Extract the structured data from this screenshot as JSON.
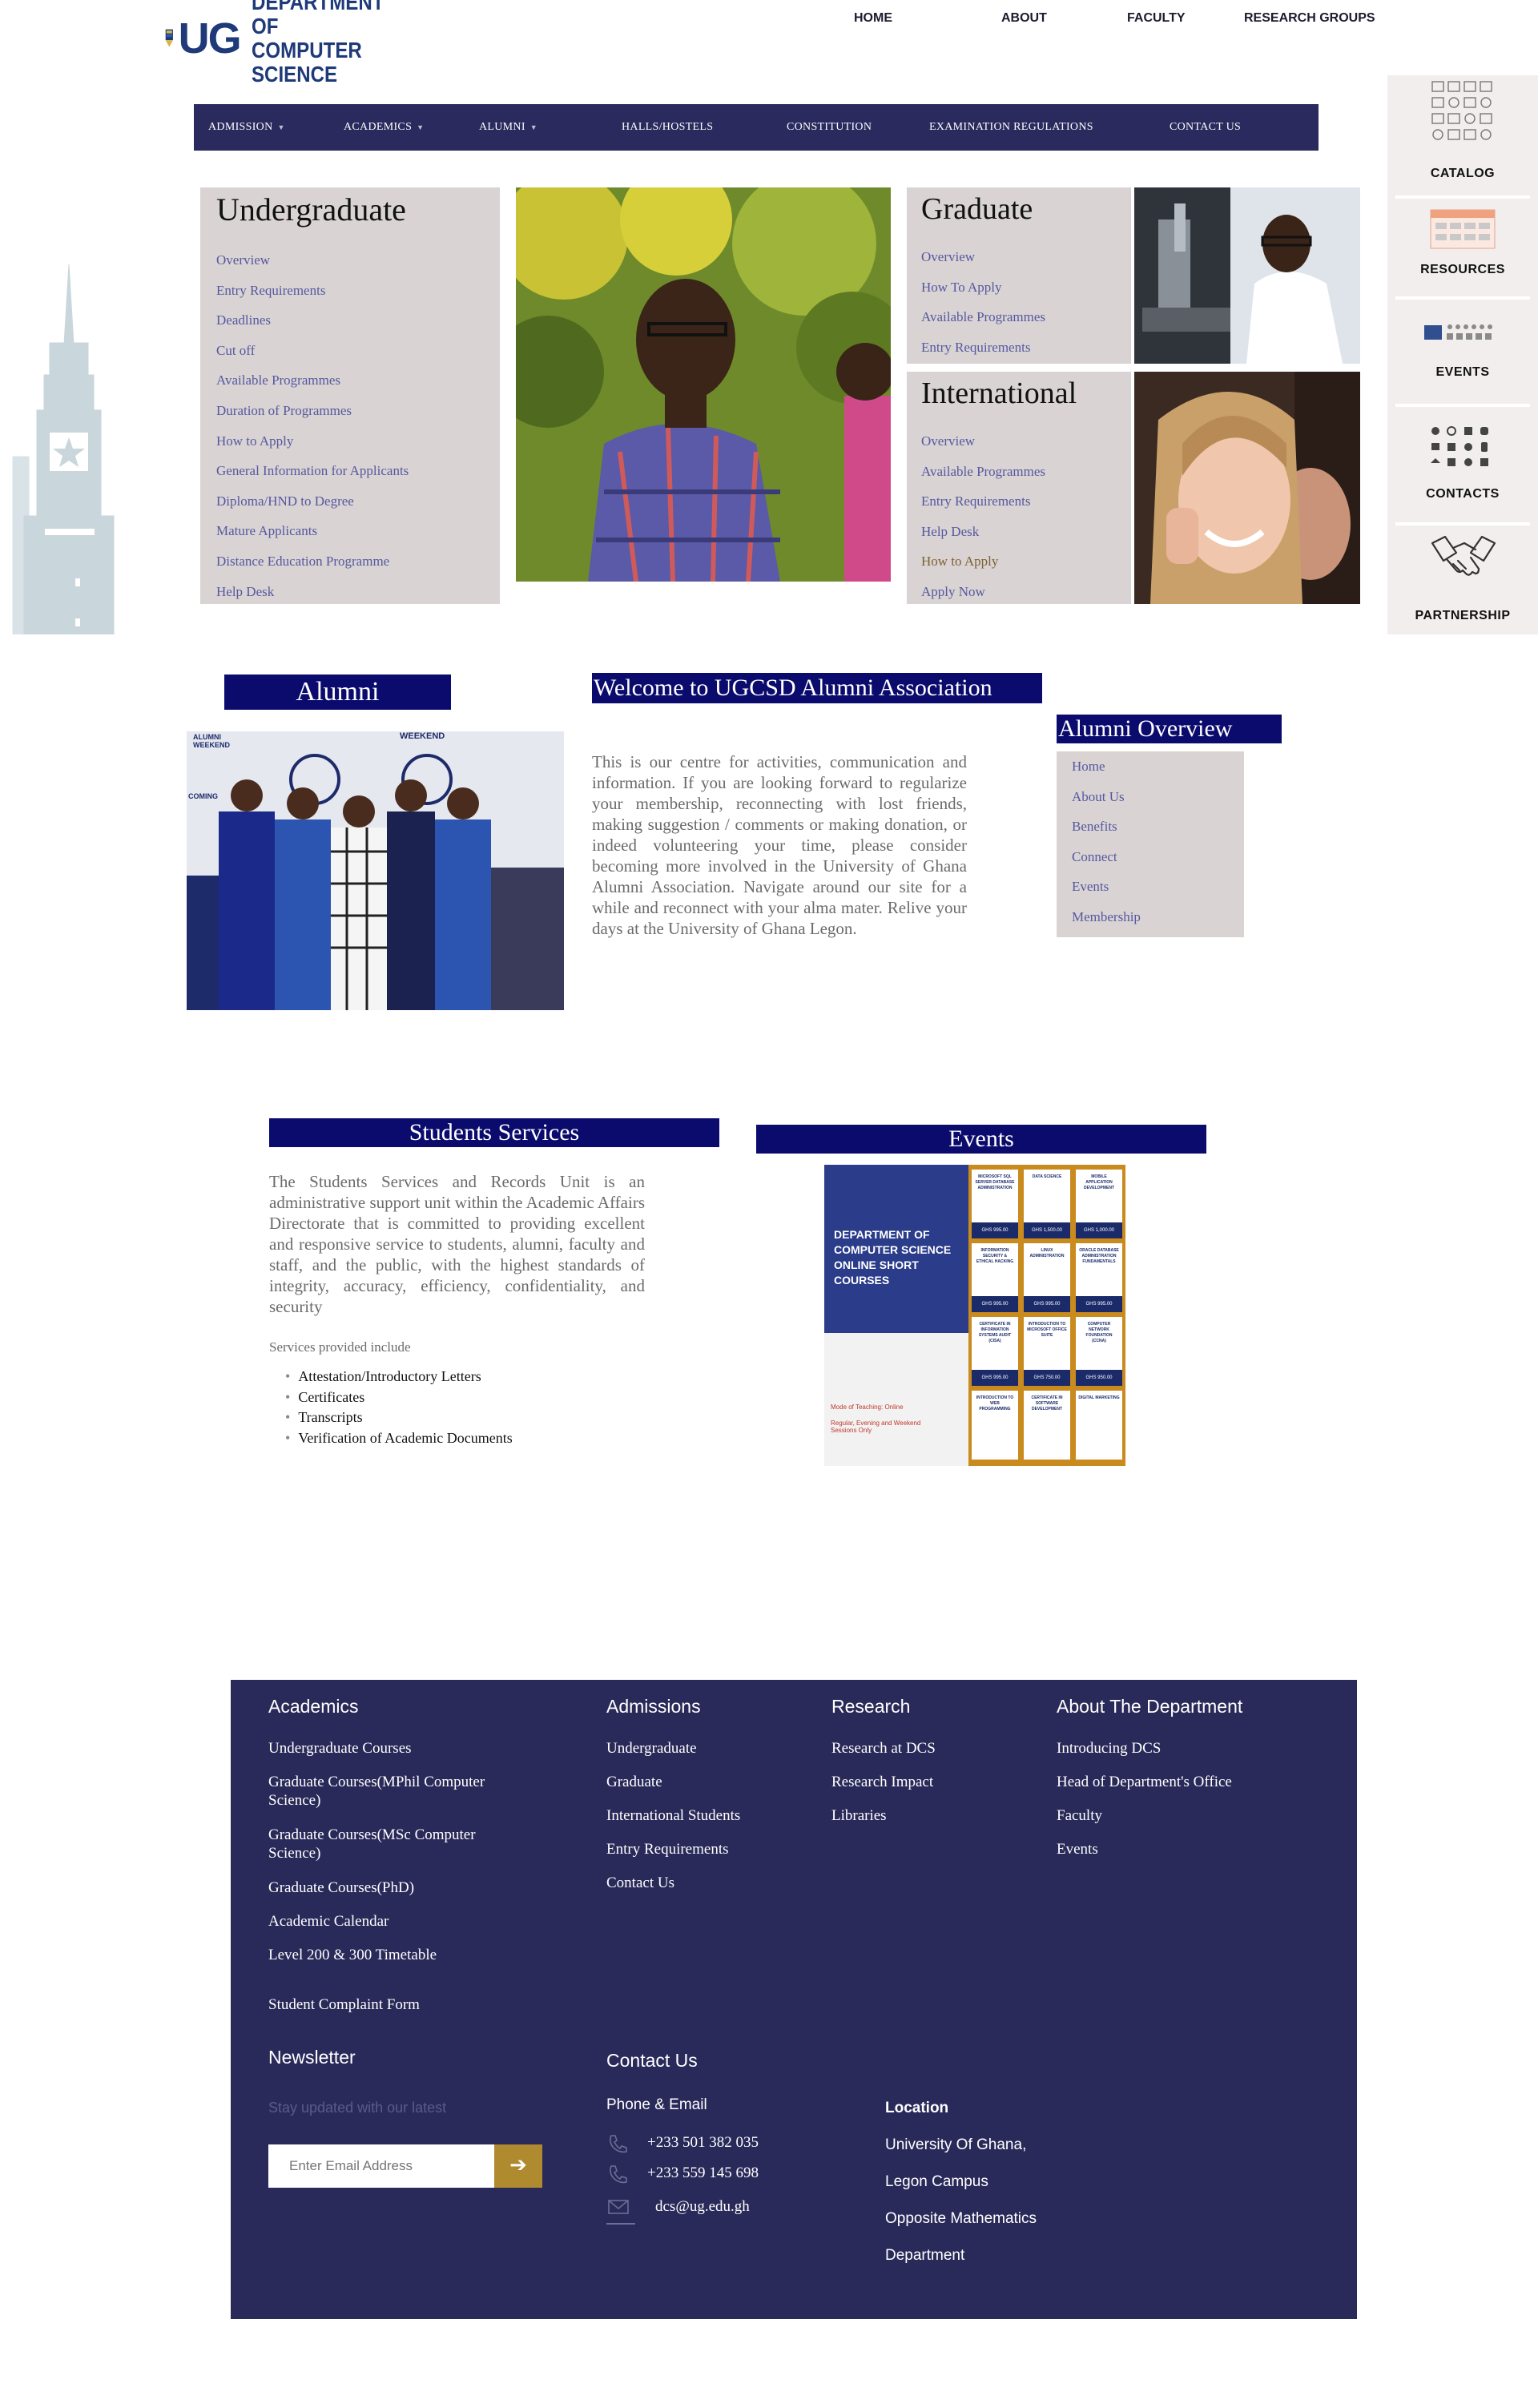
{
  "header": {
    "logo_mark": "UG",
    "logo_line1": "DEPARTMENT OF",
    "logo_line2": "COMPUTER SCIENCE",
    "top_nav": [
      "HOME",
      "ABOUT",
      "FACULTY",
      "RESEARCH GROUPS"
    ]
  },
  "navbar": {
    "items": [
      {
        "label": "ADMISSION",
        "dropdown": true
      },
      {
        "label": "ACADEMICS",
        "dropdown": true
      },
      {
        "label": "ALUMNI",
        "dropdown": true
      },
      {
        "label": "HALLS/HOSTELS",
        "dropdown": false
      },
      {
        "label": "CONSTITUTION",
        "dropdown": false
      },
      {
        "label": "EXAMINATION REGULATIONS",
        "dropdown": false
      },
      {
        "label": "CONTACT US",
        "dropdown": false
      }
    ]
  },
  "sidebar": {
    "items": [
      "CATALOG",
      "RESOURCES",
      "EVENTS",
      "CONTACTS",
      "PARTNERSHIP"
    ]
  },
  "undergraduate": {
    "title": "Undergraduate",
    "links": [
      "Overview",
      "Entry Requirements",
      "Deadlines",
      "Cut off",
      "Available Programmes",
      "Duration of Programmes",
      "How to Apply",
      "General Information for Applicants",
      "Diploma/HND to Degree",
      "Mature Applicants",
      "Distance Education Programme",
      "Help Desk"
    ]
  },
  "graduate": {
    "title": "Graduate",
    "links": [
      "Overview",
      "How To Apply",
      "Available Programmes",
      "Entry Requirements"
    ]
  },
  "international": {
    "title": "International",
    "links": [
      "Overview",
      "Available Programmes",
      "Entry Requirements",
      "Help Desk",
      "How to Apply",
      "Apply Now"
    ]
  },
  "alumni": {
    "heading": "Alumni",
    "photo_banner_left": "ALUMNI WEEKEND",
    "photo_banner_right": "WEEKEND",
    "photo_banner_coming": "COMING",
    "welcome_heading": "Welcome to UGCSD Alumni Association",
    "welcome_text": "This is our centre for activities, communication and information. If you are looking forward to regularize your membership, reconnecting with lost friends, making suggestion / comments or making donation, or indeed volunteering your time, please consider becoming more involved in the University of Ghana Alumni Association. Navigate around our site for a while and reconnect with your alma mater. Relive your days at the University of Ghana Legon.",
    "overview_heading": "Alumni Overview",
    "overview_links": [
      "Home",
      "About Us",
      "Benefits",
      "Connect",
      "Events",
      "Membership"
    ]
  },
  "students_services": {
    "heading": "Students Services",
    "text": "The Students Services and Records Unit is an administrative support unit within the Academic Affairs Directorate that is committed to providing excellent and responsive service to students, alumni, faculty and staff, and the public, with the highest standards of integrity, accuracy, efficiency, confidentiality, and security",
    "services_intro": "Services provided include",
    "services": [
      "Attestation/Introductory Letters",
      "Certificates",
      "Transcripts",
      "Verification of Academic Documents"
    ]
  },
  "events": {
    "heading": "Events",
    "poster": {
      "title": "DEPARTMENT OF COMPUTER SCIENCE ONLINE SHORT COURSES",
      "mode": "Mode of Teaching: Online",
      "sessions": "Regular, Evening and Weekend Sessions Only",
      "courses": [
        "MICROSOFT SQL SERVER DATABASE ADMINISTRATION",
        "DATA SCIENCE",
        "MOBILE APPLICATION DEVELOPMENT",
        "INFORMATION SECURITY & ETHICAL HACKING",
        "LINUX ADMINISTRATION",
        "ORACLE DATABASE ADMINISTRATION FUNDAMENTALS",
        "CERTIFICATE IN INFORMATION SYSTEMS AUDIT (CISA)",
        "INTRODUCTION TO MICROSOFT OFFICE SUITE",
        "COMPUTER NETWORK FOUNDATION (CCNA)",
        "INTRODUCTION TO WEB PROGRAMMING",
        "CERTIFICATE IN SOFTWARE DEVELOPMENT",
        "DIGITAL MARKETING"
      ],
      "prices": [
        "GHS 995.00",
        "GHS 1,500.00",
        "GHS 1,000.00",
        "GHS 995.00",
        "GHS 995.00",
        "GHS 995.00",
        "GHS 995.00",
        "GHS 750.00",
        "GHS 950.00"
      ]
    }
  },
  "footer": {
    "academics": {
      "heading": "Academics",
      "links": [
        "Undergraduate Courses",
        "Graduate Courses(MPhil Computer Science)",
        "Graduate Courses(MSc Computer Science)",
        "Graduate Courses(PhD)",
        "Academic Calendar",
        "Level 200 & 300 Timetable",
        "Student Complaint Form"
      ]
    },
    "admissions": {
      "heading": "Admissions",
      "links": [
        "Undergraduate",
        "Graduate",
        "International Students",
        "Entry Requirements",
        "Contact Us"
      ]
    },
    "research": {
      "heading": "Research",
      "links": [
        "Research at DCS",
        "Research Impact",
        "Libraries"
      ]
    },
    "about": {
      "heading": "About The Department",
      "links": [
        "Introducing DCS",
        "Head of Department's Office",
        "Faculty",
        "Events"
      ]
    },
    "newsletter": {
      "heading": "Newsletter",
      "subtext": "Stay updated with our latest",
      "email_placeholder": "Enter Email Address",
      "submit_icon": "arrow-right-icon"
    },
    "contact": {
      "heading": "Contact Us",
      "sub": "Phone & Email",
      "phone1": "+233 501 382 035",
      "phone2": "+233 559 145 698",
      "email": "dcs@ug.edu.gh"
    },
    "location": {
      "heading": "Location",
      "lines": [
        "University Of Ghana,",
        "Legon Campus",
        "Opposite Mathematics",
        "Department"
      ]
    }
  },
  "colors": {
    "navy": "#2a2a5e",
    "heading_blue": "#0b0b6e",
    "panel_grey": "#d9d3d3",
    "link_purple": "#5658a0",
    "footer_bg": "#2a2a5a",
    "newsletter_button": "#b08a2e"
  }
}
